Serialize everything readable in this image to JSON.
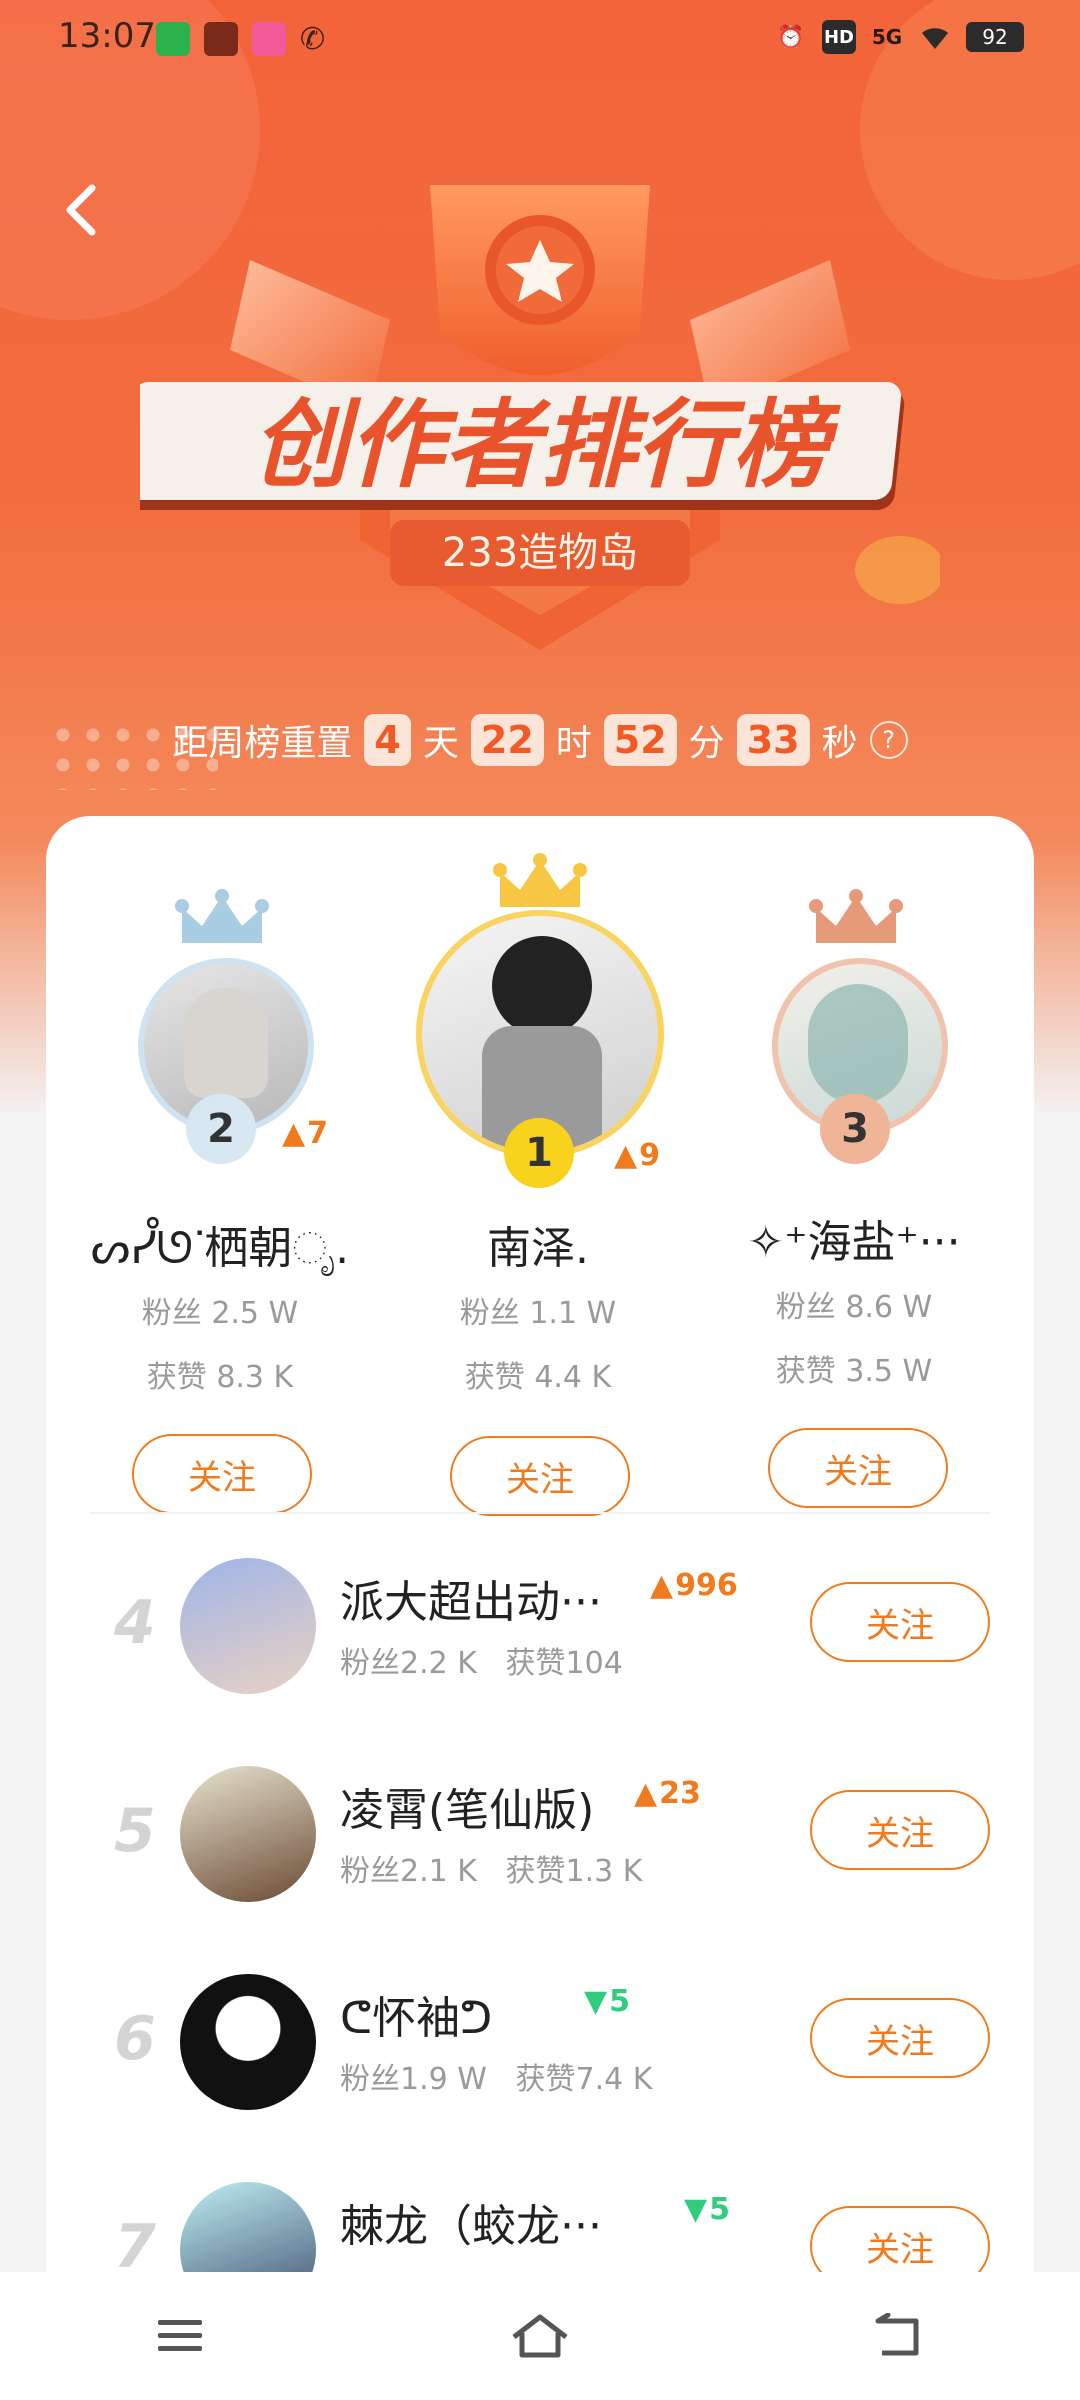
{
  "status_bar": {
    "time": "13:07",
    "battery": "92",
    "network": "5G",
    "hd": "HD"
  },
  "header": {
    "title": "创作者排行榜",
    "subtitle": "233造物岛"
  },
  "countdown": {
    "prefix": "距周榜重置",
    "days": "4",
    "days_unit": "天",
    "hours": "22",
    "hours_unit": "时",
    "minutes": "52",
    "minutes_unit": "分",
    "seconds": "33",
    "seconds_unit": "秒"
  },
  "podium": [
    {
      "rank": "2",
      "change": "7",
      "change_dir": "up",
      "name": "ᔕᓮᘎᐝ栖朝ೃ.",
      "fans_label": "粉丝",
      "fans": "2.5 W",
      "likes_label": "获赞",
      "likes": "8.3 K",
      "follow": "关注",
      "crown_color": "#a9cde3"
    },
    {
      "rank": "1",
      "change": "9",
      "change_dir": "up",
      "name": "南泽.",
      "fans_label": "粉丝",
      "fans": "1.1 W",
      "likes_label": "获赞",
      "likes": "4.4 K",
      "follow": "关注",
      "crown_color": "#f7c744"
    },
    {
      "rank": "3",
      "change": "",
      "change_dir": "",
      "name": "✧⁺海盐⁺···",
      "fans_label": "粉丝",
      "fans": "8.6 W",
      "likes_label": "获赞",
      "likes": "3.5 W",
      "follow": "关注",
      "crown_color": "#e59b7a"
    }
  ],
  "list": [
    {
      "rank": "4",
      "name": "派大超出动···",
      "change": "996",
      "change_dir": "up",
      "fans_label": "粉丝",
      "fans": "2.2 K",
      "likes_label": "获赞",
      "likes": "104",
      "follow": "关注"
    },
    {
      "rank": "5",
      "name": "凌霄(笔仙版)",
      "change": "23",
      "change_dir": "up",
      "fans_label": "粉丝",
      "fans": "2.1 K",
      "likes_label": "获赞",
      "likes": "1.3 K",
      "follow": "关注"
    },
    {
      "rank": "6",
      "name": "ᕦ怀袖ᕤ",
      "change": "5",
      "change_dir": "down",
      "fans_label": "粉丝",
      "fans": "1.9 W",
      "likes_label": "获赞",
      "likes": "7.4 K",
      "follow": "关注"
    },
    {
      "rank": "7",
      "name": "棘龙（蛟龙···",
      "change": "5",
      "change_dir": "down",
      "fans_label": "",
      "fans": "",
      "likes_label": "",
      "likes": "",
      "follow": "关注"
    }
  ],
  "colors": {
    "accent": "#f07a1c",
    "hero": "#f3633a",
    "up": "#f07a1c",
    "down": "#2fce7d"
  }
}
